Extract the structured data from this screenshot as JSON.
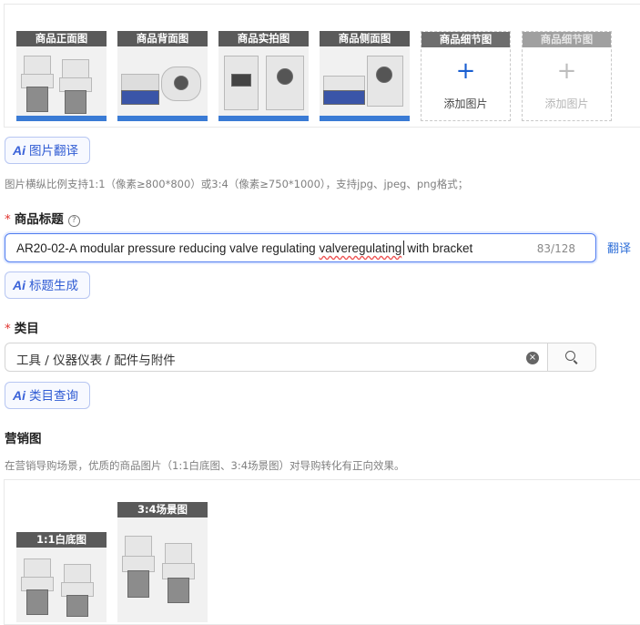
{
  "product_images": {
    "slots": [
      {
        "label": "商品正面图"
      },
      {
        "label": "商品背面图"
      },
      {
        "label": "商品实拍图"
      },
      {
        "label": "商品侧面图"
      }
    ],
    "add_slots": [
      {
        "label": "商品细节图",
        "add_text": "添加图片",
        "plus": "+"
      },
      {
        "label": "商品细节图",
        "add_text": "添加图片",
        "plus": "+"
      }
    ]
  },
  "ai_image_translate": {
    "ai": "Ai",
    "label": "图片翻译"
  },
  "image_hint": "图片横纵比例支持1:1（像素≥800*800）或3:4（像素≥750*1000），支持jpg、jpeg、png格式；",
  "title_section": {
    "required_mark": "*",
    "label": "商品标题",
    "help_icon": "?",
    "value_part1": "AR20-02-A modular pressure reducing valve  regulating ",
    "value_squiggle": "valveregulating",
    "value_part2": "with bracket",
    "count": "83/128",
    "translate_link": "翻译"
  },
  "ai_title_generate": {
    "ai": "Ai",
    "label": "标题生成"
  },
  "category_section": {
    "required_mark": "*",
    "label": "类目",
    "value": "工具 / 仪器仪表 / 配件与附件",
    "clear_icon": "×"
  },
  "ai_category_query": {
    "ai": "Ai",
    "label": "类目查询"
  },
  "marketing_section": {
    "label": "营销图",
    "hint": "在营销导购场景，优质的商品图片（1:1白底图、3:4场景图）对导购转化有正向效果。",
    "slots": [
      {
        "label": "1:1白底图"
      },
      {
        "label": "3:4场景图"
      }
    ]
  },
  "colors": {
    "accent": "#2f6fd8",
    "required": "#e0322d",
    "slot_label_bg": "#5a5a5a"
  }
}
